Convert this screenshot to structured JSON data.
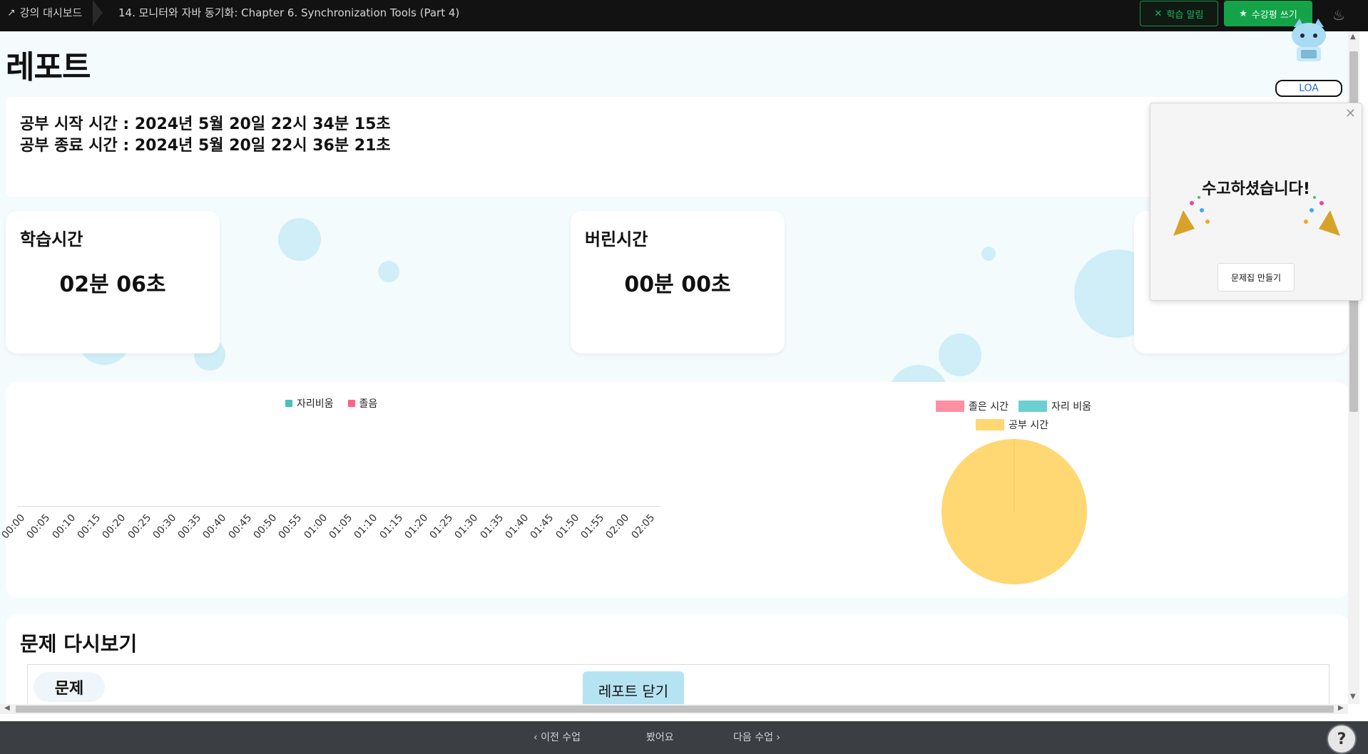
{
  "topbar": {
    "dashboard_label": "강의 대시보드",
    "lecture_title": "14. 모니터와 자바 동기화: Chapter 6. Synchronization Tools (Part 4)",
    "alarm_label": "학습 알림",
    "review_label": "수강평 쓰기"
  },
  "report": {
    "title": "레포트",
    "start_time": "공부 시작 시간 : 2024년 5월 20일 22시 34분 15초",
    "end_time": "공부 종료 시간 : 2024년 5월 20일 22시 36분 21초",
    "cards": [
      {
        "label": "학습시간",
        "value": "02분 06초"
      },
      {
        "label": "버린시간",
        "value": "00분 00초"
      }
    ]
  },
  "chart_data": [
    {
      "type": "line",
      "series": [
        {
          "name": "자리비움",
          "color": "#4bc0c0",
          "values": []
        },
        {
          "name": "졸음",
          "color": "#ff6384",
          "values": []
        }
      ],
      "x": [
        "00:00",
        "00:05",
        "00:10",
        "00:15",
        "00:20",
        "00:25",
        "00:30",
        "00:35",
        "00:40",
        "00:45",
        "00:50",
        "00:55",
        "01:00",
        "01:05",
        "01:10",
        "01:15",
        "01:20",
        "01:25",
        "01:30",
        "01:35",
        "01:40",
        "01:45",
        "01:50",
        "01:55",
        "02:00",
        "02:05"
      ]
    },
    {
      "type": "pie",
      "labels": [
        "졸은 시간",
        "자리 비움",
        "공부 시간"
      ],
      "colors": [
        "#ff8fa3",
        "#6ccfd2",
        "#ffd873"
      ],
      "values": [
        0,
        0,
        100
      ]
    }
  ],
  "review": {
    "heading": "문제 다시보기",
    "tab_label": "문제",
    "close_label": "레포트 닫기"
  },
  "popup": {
    "message": "수고하셨습니다!",
    "make_label": "문제집 만들기",
    "loa_label": "LOA"
  },
  "bottombar": {
    "prev_label": "이전 수업",
    "done_label": "봤어요",
    "next_label": "다음 수업",
    "help_label": "?"
  }
}
